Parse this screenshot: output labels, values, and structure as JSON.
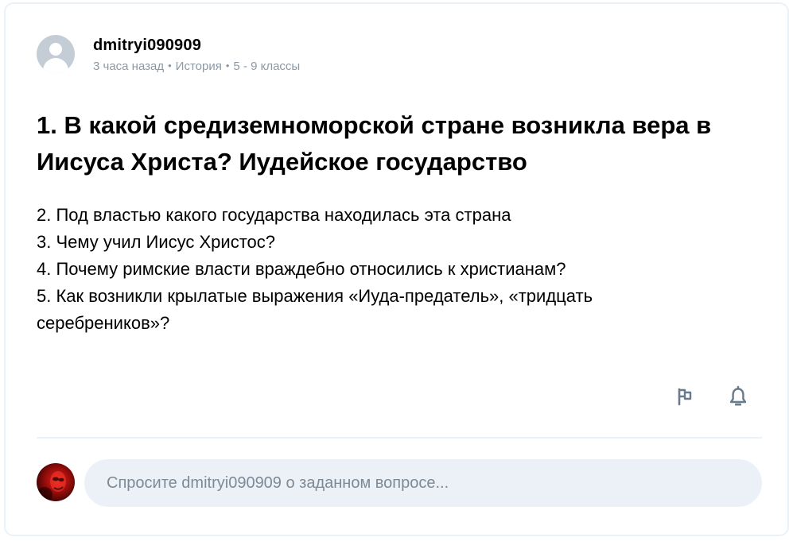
{
  "author": {
    "username": "dmitryi090909",
    "posted": "3 часа назад",
    "subject": "История",
    "grade": "5 - 9 классы",
    "separator": "•"
  },
  "question": {
    "title": "1. В какой средиземноморской стране возникла вера в Иисуса Христа? Иудейское государство",
    "lines": [
      "2. Под властью какого государства находилась эта страна",
      "3. Чему учил Иисус Христос?",
      "4. Почему римские власти враждебно относились к христианам?",
      "5. Как возникли крылатые выражения «Иуда-предатель», «тридцать",
      "серебреников»?"
    ]
  },
  "actions": {
    "report_icon": "flag-icon",
    "follow_icon": "bell-icon"
  },
  "comment": {
    "placeholder": "Спросите dmitryi090909 о заданном вопросе..."
  },
  "colors": {
    "border": "#ebf2f7",
    "meta_text": "#8c99a5",
    "icon": "#687b8c",
    "input_bg": "#ebf1f7",
    "placeholder": "#7d8a96"
  }
}
